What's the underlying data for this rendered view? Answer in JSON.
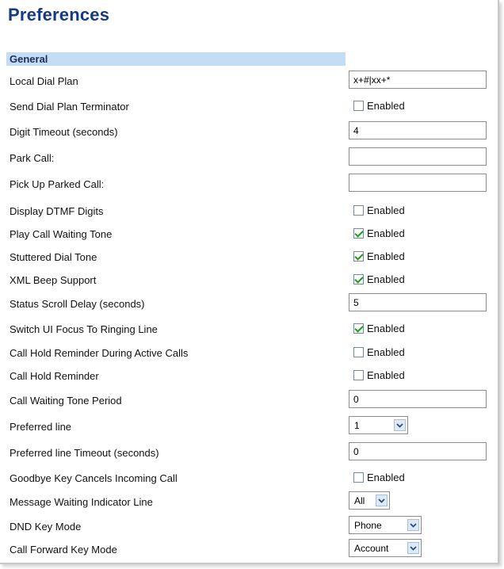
{
  "page": {
    "title": "Preferences"
  },
  "section": {
    "title": "General"
  },
  "rows": [
    {
      "label": "Local Dial Plan",
      "type": "text",
      "value": "x+#|xx+*"
    },
    {
      "label": "Send Dial Plan Terminator",
      "type": "checkbox",
      "checked": false,
      "option_label": "Enabled"
    },
    {
      "label": "Digit Timeout (seconds)",
      "type": "text",
      "value": "4"
    },
    {
      "label": "Park Call:",
      "type": "text",
      "value": ""
    },
    {
      "label": "Pick Up Parked Call:",
      "type": "text",
      "value": ""
    },
    {
      "label": "Display DTMF Digits",
      "type": "checkbox",
      "checked": false,
      "option_label": "Enabled"
    },
    {
      "label": "Play Call Waiting Tone",
      "type": "checkbox",
      "checked": true,
      "option_label": "Enabled"
    },
    {
      "label": "Stuttered Dial Tone",
      "type": "checkbox",
      "checked": true,
      "option_label": "Enabled"
    },
    {
      "label": "XML Beep Support",
      "type": "checkbox",
      "checked": true,
      "option_label": "Enabled"
    },
    {
      "label": "Status Scroll Delay (seconds)",
      "type": "text",
      "value": "5"
    },
    {
      "label": "Switch UI Focus To Ringing Line",
      "type": "checkbox",
      "checked": true,
      "option_label": "Enabled"
    },
    {
      "label": "Call Hold Reminder During Active Calls",
      "type": "checkbox",
      "checked": false,
      "option_label": "Enabled"
    },
    {
      "label": "Call Hold Reminder",
      "type": "checkbox",
      "checked": false,
      "option_label": "Enabled"
    },
    {
      "label": "Call Waiting Tone Period",
      "type": "text",
      "value": "0"
    },
    {
      "label": "Preferred line",
      "type": "select",
      "value": "1"
    },
    {
      "label": "Preferred line Timeout (seconds)",
      "type": "text",
      "value": "0"
    },
    {
      "label": "Goodbye Key Cancels Incoming Call",
      "type": "checkbox",
      "checked": false,
      "option_label": "Enabled"
    },
    {
      "label": "Message Waiting Indicator Line",
      "type": "select",
      "value": "All"
    },
    {
      "label": "DND Key Mode",
      "type": "select",
      "value": "Phone"
    },
    {
      "label": "Call Forward Key Mode",
      "type": "select",
      "value": "Account"
    }
  ],
  "icons": {
    "select_arrow": "chevron-down-icon",
    "check_mark": "checkmark-icon"
  },
  "colors": {
    "title": "#163a82",
    "section_bar": "#c5dcf5",
    "check_mark": "#1e9a1e"
  }
}
